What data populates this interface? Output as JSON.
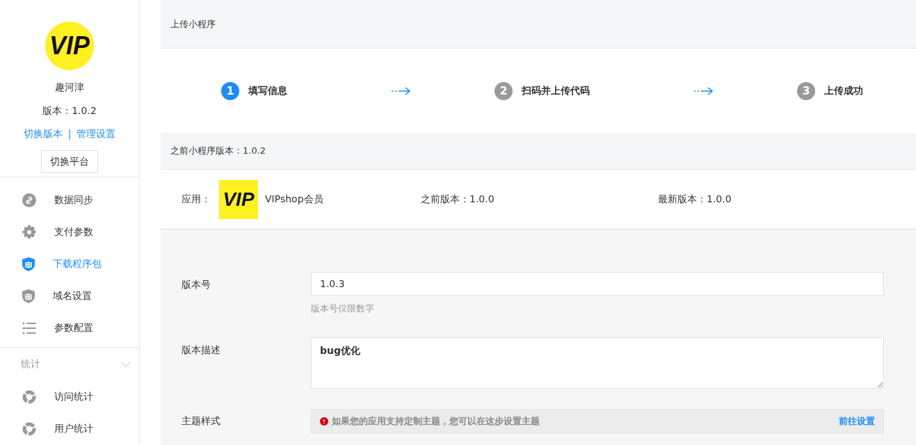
{
  "sidebar": {
    "logo_text": "VIP",
    "name": "趣河津",
    "version": "版本：1.0.2",
    "links": [
      "切换版本",
      "管理设置"
    ],
    "link_separator": "|",
    "switch_button": "切换平台",
    "menu": [
      {
        "label": "数据同步",
        "kind": "link",
        "selected": false
      },
      {
        "label": "支付参数",
        "kind": "gear",
        "selected": false
      },
      {
        "label": "下载程序包",
        "kind": "shield",
        "selected": true
      },
      {
        "label": "域名设置",
        "kind": "shield",
        "selected": false
      },
      {
        "label": "参数配置",
        "kind": "list",
        "selected": false
      }
    ],
    "section": {
      "title": "统计",
      "expanded": true,
      "items": [
        {
          "label": "访问统计",
          "kind": "donut",
          "selected": false
        },
        {
          "label": "用户统计",
          "kind": "donut",
          "selected": false
        }
      ]
    }
  },
  "header": {
    "title": "上传小程序"
  },
  "steps": [
    {
      "number": "1",
      "label": "填写信息",
      "selected": true
    },
    {
      "number": "2",
      "label": "扫码并上传代码",
      "selected": false
    },
    {
      "number": "3",
      "label": "上传成功",
      "selected": false
    }
  ],
  "previous_bar": {
    "title": "之前小程序版本：1.0.2"
  },
  "app_row": {
    "label": "应用：",
    "logo_text": "VIP",
    "name": "VIPshop会员",
    "previous": "之前版本：1.0.0",
    "latest": "最新版本：1.0.0"
  },
  "form": {
    "version": {
      "label": "版本号",
      "value": "1.0.3",
      "hint": "版本号仅限数字"
    },
    "description": {
      "label": "版本描述",
      "value": "bug优化"
    },
    "theme": {
      "label": "主题样式",
      "notice": "如果您的应用支持定制主题，您可以在这步设置主题",
      "link": "前往设置"
    }
  }
}
